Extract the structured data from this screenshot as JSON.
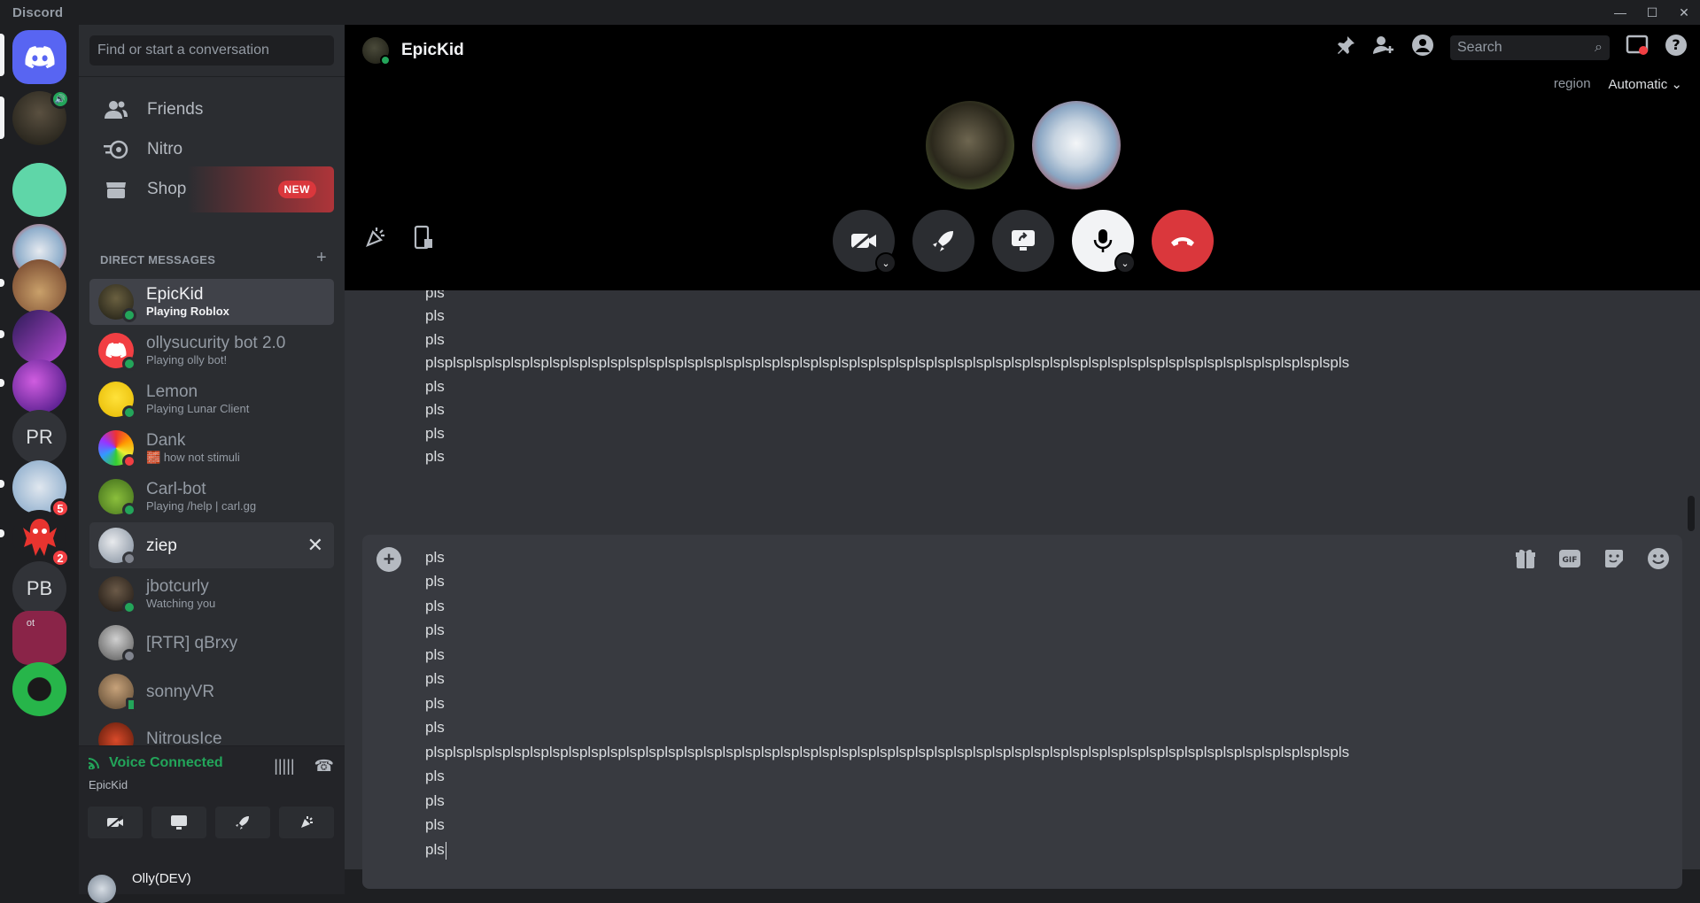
{
  "window": {
    "app_name": "Discord",
    "controls": [
      "—",
      "☐",
      "✕"
    ]
  },
  "servers": [
    {
      "type": "home",
      "label": ""
    },
    {
      "type": "avatar",
      "label": "",
      "voice": true
    },
    {
      "type": "avatar",
      "label": ""
    },
    {
      "type": "avatar",
      "label": ""
    },
    {
      "type": "avatar",
      "label": ""
    },
    {
      "type": "avatar",
      "label": ""
    },
    {
      "type": "avatar",
      "label": ""
    },
    {
      "type": "text",
      "label": "PR"
    },
    {
      "type": "avatar",
      "label": "",
      "badge": "5"
    },
    {
      "type": "avatar",
      "label": "",
      "badge": "2"
    },
    {
      "type": "text",
      "label": "PB"
    },
    {
      "type": "text",
      "label": "ot"
    },
    {
      "type": "avatar",
      "label": ""
    }
  ],
  "sidebar": {
    "search_placeholder": "Find or start a conversation",
    "nav": [
      {
        "label": "Friends"
      },
      {
        "label": "Nitro"
      },
      {
        "label": "Shop",
        "badge": "NEW"
      }
    ],
    "dm_header": "DIRECT MESSAGES",
    "dms": [
      {
        "name": "EpicKid",
        "sub": "Playing Roblox",
        "status": "online"
      },
      {
        "name": "ollysucurity bot 2.0",
        "sub": "Playing olly bot!",
        "status": "online"
      },
      {
        "name": "Lemon",
        "sub": "Playing Lunar Client",
        "status": "online"
      },
      {
        "name": "Dank",
        "sub": "how not stimuli",
        "status": "dnd"
      },
      {
        "name": "Carl-bot",
        "sub": "Playing /help | carl.gg",
        "status": "online"
      },
      {
        "name": "ziep",
        "sub": "",
        "status": "offline"
      },
      {
        "name": "jbotcurly",
        "sub": "Watching you",
        "status": "online"
      },
      {
        "name": "[RTR] qBrxy",
        "sub": "",
        "status": "offline"
      },
      {
        "name": "sonnyVR",
        "sub": "",
        "status": "mobile"
      },
      {
        "name": "NitrousIce",
        "sub": "",
        "status": "offline"
      }
    ],
    "voice": {
      "title": "Voice Connected",
      "channel": "EpicKid"
    },
    "user": {
      "name": "Olly(DEV)"
    }
  },
  "call": {
    "title": "EpicKid",
    "search_placeholder": "Search",
    "region_label": "region",
    "region_value": "Automatic"
  },
  "messages": [
    "pls",
    "pls",
    "pls",
    "plsplsplsplsplsplsplsplsplsplsplsplsplsplsplsplsplsplsplsplsplsplsplsplsplsplsplsplsplsplsplsplsplsplsplsplsplsplsplsplsplsplsplsplsplsplsplspls",
    "pls",
    "pls",
    "pls",
    "pls"
  ],
  "composer_lines": [
    "pls",
    "pls",
    "pls",
    "pls",
    "pls",
    "pls",
    "pls",
    "pls",
    "plsplsplsplsplsplsplsplsplsplsplsplsplsplsplsplsplsplsplsplsplsplsplsplsplsplsplsplsplsplsplsplsplsplsplsplsplsplsplsplsplsplsplsplsplsplsplspls",
    "pls",
    "pls",
    "pls",
    "pls"
  ],
  "colors": {
    "accent": "#5865f2",
    "online": "#23a55a",
    "danger": "#da373c"
  }
}
